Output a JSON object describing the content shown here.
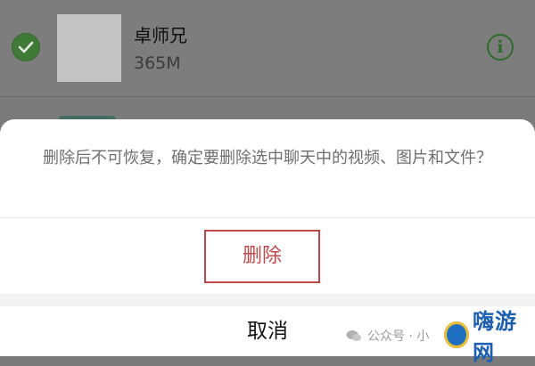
{
  "file_list": {
    "item": {
      "name": "卓师兄",
      "size": "365M",
      "checked": true
    }
  },
  "dialog": {
    "message": "删除后不可恢复，确定要删除选中聊天中的视频、图片和文件？",
    "delete_label": "删除",
    "cancel_label": "取消"
  },
  "watermark": {
    "source": "公众号 · 小",
    "brand": "嗨游网"
  },
  "colors": {
    "delete": "#c0484a",
    "check": "#3f7a36",
    "overlay": "#7b7b7b"
  }
}
